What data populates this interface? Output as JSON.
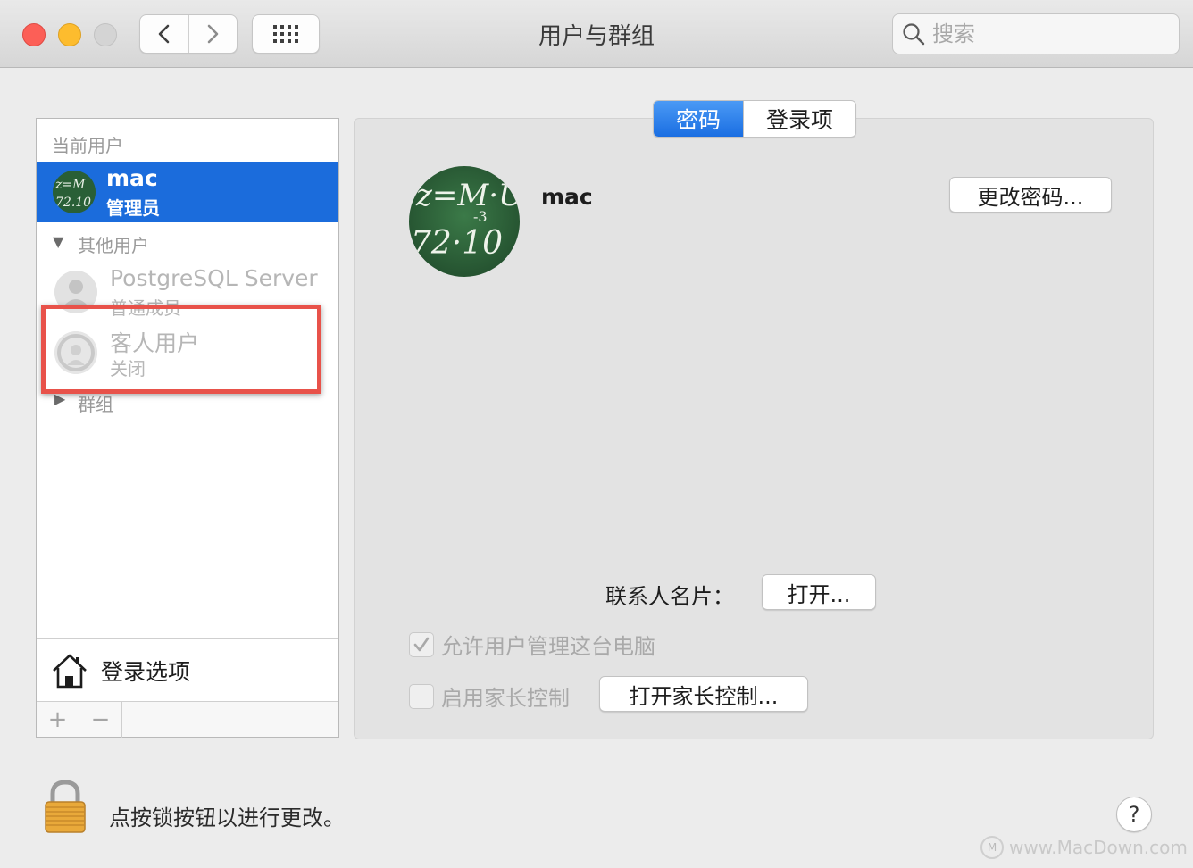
{
  "window": {
    "title": "用户与群组"
  },
  "search": {
    "placeholder": "搜索"
  },
  "sidebar": {
    "current_users_label": "当前用户",
    "current_user": {
      "name": "mac",
      "role": "管理员"
    },
    "other_users_label": "其他用户",
    "other_users": [
      {
        "name": "PostgreSQL Server",
        "role": "普通成员"
      },
      {
        "name": "客人用户",
        "role": "关闭"
      }
    ],
    "groups_label": "群组",
    "login_options_label": "登录选项",
    "add_label": "+",
    "remove_label": "−"
  },
  "tabs": [
    {
      "label": "密码",
      "active": true
    },
    {
      "label": "登录项",
      "active": false
    }
  ],
  "main": {
    "user_name": "mac",
    "change_password_label": "更改密码...",
    "contact_card_label": "联系人名片：",
    "open_label": "打开...",
    "allow_admin_label": "允许用户管理这台电脑",
    "allow_admin_checked": true,
    "parental_label": "启用家长控制",
    "parental_checked": false,
    "open_parental_label": "打开家长控制..."
  },
  "footer": {
    "lock_text": "点按锁按钮以进行更改。",
    "help_label": "?",
    "watermark": "www.MacDown.com"
  },
  "colors": {
    "selection": "#1b6cdc",
    "highlight_box": "#e8524a",
    "chalkboard": "#2f6b3c"
  }
}
